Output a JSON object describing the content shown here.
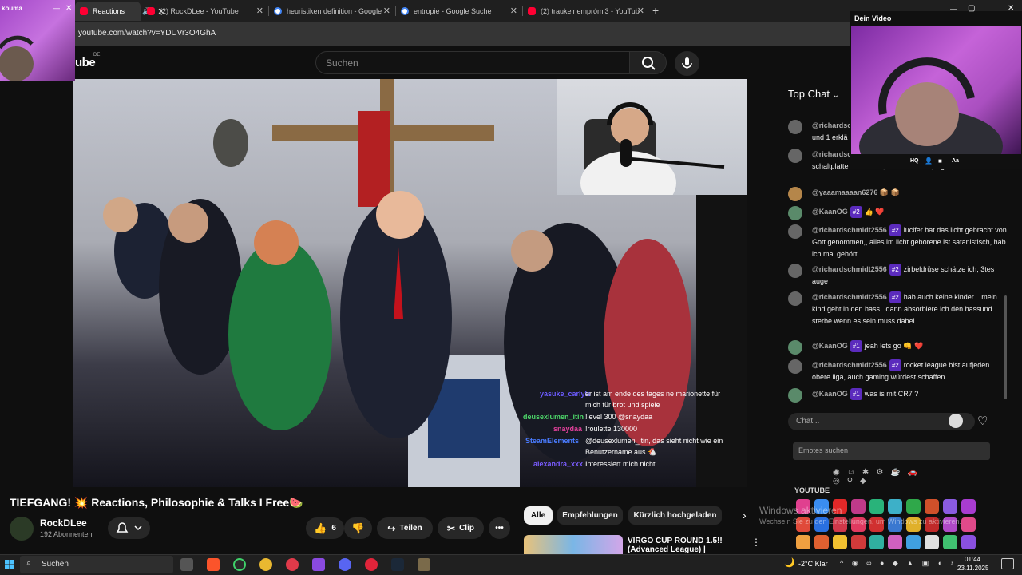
{
  "browser": {
    "tabs": [
      {
        "label": "Reactions",
        "active": true,
        "icon": "youtube-icon"
      },
      {
        "label": "(2) RockDLee - YouTube",
        "icon": "youtube-icon"
      },
      {
        "label": "heuristiken definition - Google",
        "icon": "google-icon"
      },
      {
        "label": "entropie - Google Suche",
        "icon": "google-icon"
      },
      {
        "label": "(2) traukeinemprómi3 - YouTub",
        "icon": "youtube-icon"
      }
    ],
    "url": "youtube.com/watch?v=YDUVr3O4GhA"
  },
  "pip_small": {
    "title": "kouma"
  },
  "pip_large": {
    "title": "Dein Video",
    "controls": [
      "HQ",
      "Aa"
    ]
  },
  "youtube": {
    "logo": "ube",
    "region": "DE",
    "search_placeholder": "Suchen"
  },
  "video": {
    "title": "TIEFGANG! 💥 Reactions, Philosophie & Talks I Free🍉",
    "channel": "RockDLee",
    "subscribers": "192 Abonnenten",
    "likes": "6",
    "share_label": "Teilen",
    "clip_label": "Clip",
    "overlay_chat": [
      {
        "user": "yasuke_carlyle",
        "text": "er ist am ende des tages ne marionette für",
        "color": "#6b5bff"
      },
      {
        "user": "",
        "text": "mich für brot und spiele",
        "color": "#ffffff"
      },
      {
        "user": "deusexlumen_itin",
        "text": "!level 300 @snaydaa",
        "color": "#4dd86a"
      },
      {
        "user": "snaydaa",
        "text": "!roulette 130000",
        "color": "#e0409a"
      },
      {
        "user": "SteamElements",
        "text": "@deusexlumen_itin, das sieht nicht wie ein",
        "color": "#4a7cff"
      },
      {
        "user": "",
        "text": "Benutzername aus 🐔",
        "color": "#ffffff"
      },
      {
        "user": "alexandra_xxx",
        "text": "Interessiert mich nicht",
        "color": "#7a5cff"
      }
    ]
  },
  "chips": [
    "Alle",
    "Empfehlungen",
    "Kürzlich hochgeladen"
  ],
  "recommendation": {
    "title": "VIRGO CUP ROUND 1.5!!",
    "subtitle": "(Advanced League) |"
  },
  "watermark": {
    "title": "Windows aktivieren",
    "subtitle": "Wechseln Sie zu den Einstellungen, um Windows zu aktivieren."
  },
  "chat": {
    "header": "Top Chat",
    "messages": [
      {
        "user": "@richardsc",
        "badge": "",
        "text": "und 1 erklä"
      },
      {
        "user": "@richardsc",
        "badge": "",
        "text": "schaltplatte simulieren, nur emulieren, digital emulieren"
      },
      {
        "user": "@yaaamaaaan6276",
        "badge": "",
        "text": "📦 📦"
      },
      {
        "user": "@KaanOG",
        "badge": "#2",
        "text": "👍 ❤️"
      },
      {
        "user": "@richardschmidt2556",
        "badge": "#2",
        "text": "lucifer hat das licht gebracht von Gott genommen,, alles im licht geborene ist satanistisch, hab ich mal gehört"
      },
      {
        "user": "@richardschmidt2556",
        "badge": "#2",
        "text": "zirbeldrüse schätze ich, 3tes auge"
      },
      {
        "user": "@richardschmidt2556",
        "badge": "#2",
        "text": "hab auch keine kinder... mein kind geht in den hass.. dann absorbiere ich den hassund sterbe wenn es sein muss dabei"
      },
      {
        "user": "@KaanOG",
        "badge": "#1",
        "text": "jeah lets go 👊 ❤️"
      },
      {
        "user": "@richardschmidt2556",
        "badge": "#2",
        "text": "rocket league bist aufjeden obere liga, auch gaming würdest schaffen"
      },
      {
        "user": "@KaanOG",
        "badge": "#1",
        "text": "was is mit CR7 ?"
      }
    ],
    "input_placeholder": "Chat...",
    "emote_search_placeholder": "Emotes suchen",
    "emote_section": "YOUTUBE"
  },
  "taskbar": {
    "search": "Suchen",
    "weather": "-2°C  Klar",
    "time": "01:44",
    "date": "23.11.2025"
  }
}
